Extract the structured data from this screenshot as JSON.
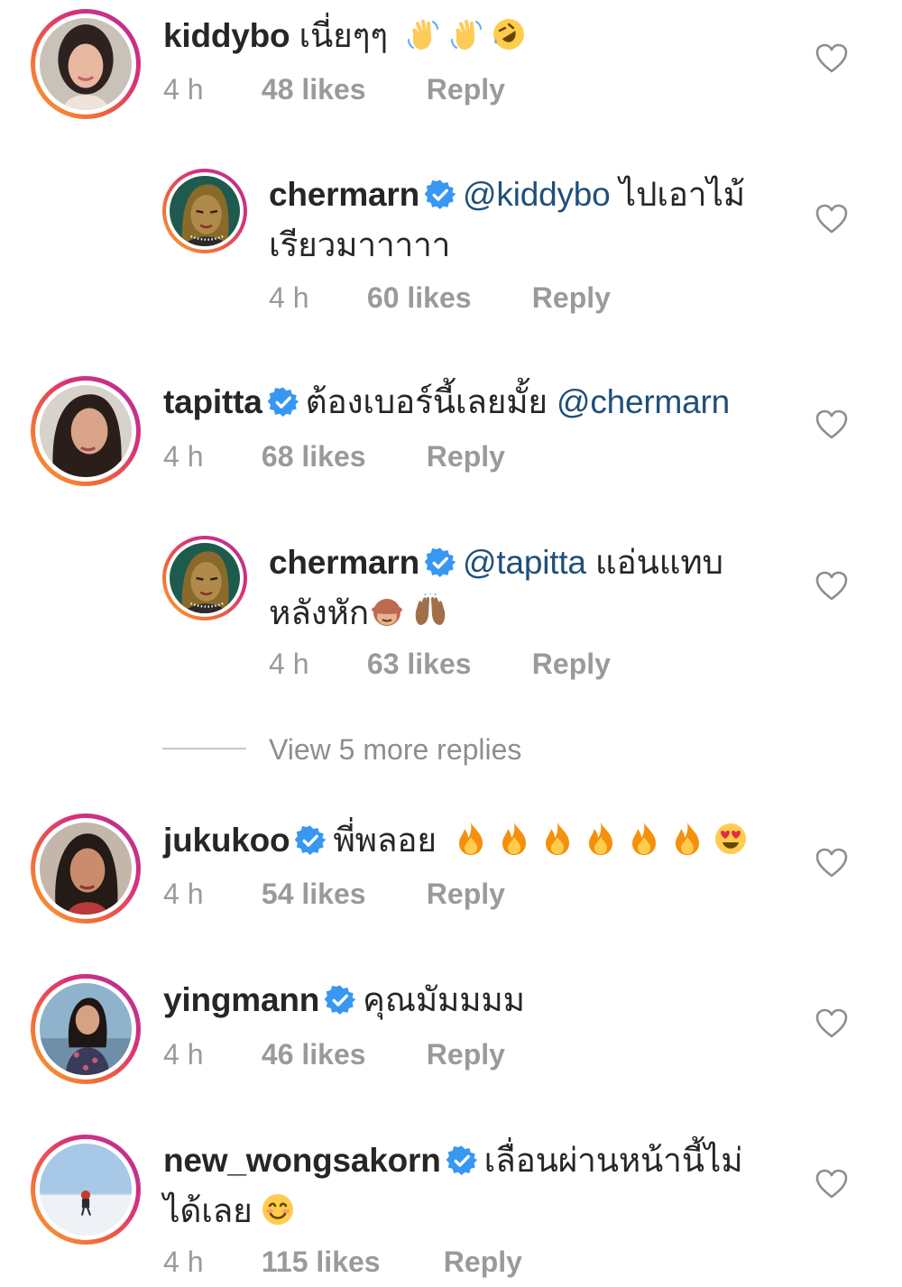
{
  "comments": [
    {
      "username": "kiddybo",
      "verified": false,
      "text": "เนี่ยๆๆ",
      "mention": "",
      "emojis": [
        "waving-hand",
        "waving-hand",
        "rofl"
      ],
      "time": "4 h",
      "likes": "48 likes",
      "reply": "Reply"
    },
    {
      "username": "chermarn",
      "verified": true,
      "mention": "@kiddybo",
      "text_line1": "ไปเอาไม้",
      "text_line2": "เรียวมาาาาา",
      "time": "4 h",
      "likes": "60 likes",
      "reply": "Reply"
    },
    {
      "username": "tapitta",
      "verified": true,
      "text": "ต้องเบอร์นี้เลยมั้ย",
      "mention": "@chermarn",
      "time": "4 h",
      "likes": "68 likes",
      "reply": "Reply"
    },
    {
      "username": "chermarn",
      "verified": true,
      "mention": "@tapitta",
      "text_line1": "แอ่นแทบ",
      "text_line2": "หลังหัก",
      "emojis": [
        "see-no-evil-monkey",
        "raising-hands"
      ],
      "time": "4 h",
      "likes": "63 likes",
      "reply": "Reply"
    },
    {
      "username": "jukukoo",
      "verified": true,
      "text": "พี่พลอย",
      "emojis": [
        "fire",
        "fire",
        "fire",
        "fire",
        "fire",
        "fire",
        "heart-eyes"
      ],
      "time": "4 h",
      "likes": "54 likes",
      "reply": "Reply"
    },
    {
      "username": "yingmann",
      "verified": true,
      "text": "คุณมัมมมม",
      "time": "4 h",
      "likes": "46 likes",
      "reply": "Reply"
    },
    {
      "username": "new_wongsakorn",
      "verified": true,
      "text_line1": "เลื่อนผ่านหน้านี้ไม่",
      "text_line2": "ได้เลย",
      "emojis": [
        "smiling-face"
      ],
      "time": "4 h",
      "likes": "115 likes",
      "reply": "Reply"
    }
  ],
  "view_more_replies": "View 5 more replies",
  "colors": {
    "text": "#262626",
    "meta": "#9a9a9a",
    "mention": "#1f4f7a",
    "verified": "#3897f0"
  }
}
